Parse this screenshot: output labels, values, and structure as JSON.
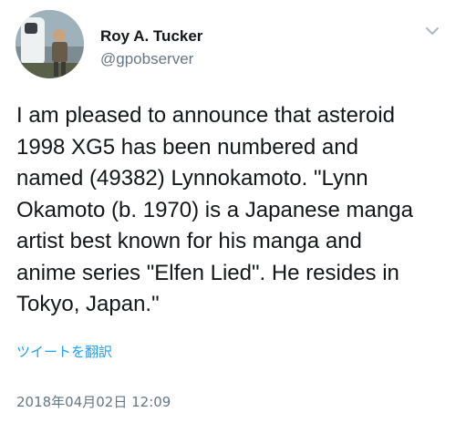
{
  "author": {
    "display_name": "Roy A. Tucker",
    "handle": "@gpobserver",
    "avatar_icon": "observer-with-telescope-avatar"
  },
  "tweet": {
    "text": "I am pleased to announce that asteroid\n1998 XG5 has been numbered and\nnamed (49382) Lynnokamoto. \"Lynn\nOkamoto (b. 1970) is a Japanese manga\nartist best known for his manga and\nanime series \"Elfen Lied\". He resides in\nTokyo, Japan.\"",
    "translate_label": "ツイートを翻訳",
    "timestamp": "2018年04月02日 12:09"
  },
  "menu": {
    "icon": "chevron-down-icon"
  },
  "colors": {
    "text": "#14171a",
    "secondary": "#657786",
    "link": "#1da1f2",
    "caret": "#aab8c2"
  }
}
